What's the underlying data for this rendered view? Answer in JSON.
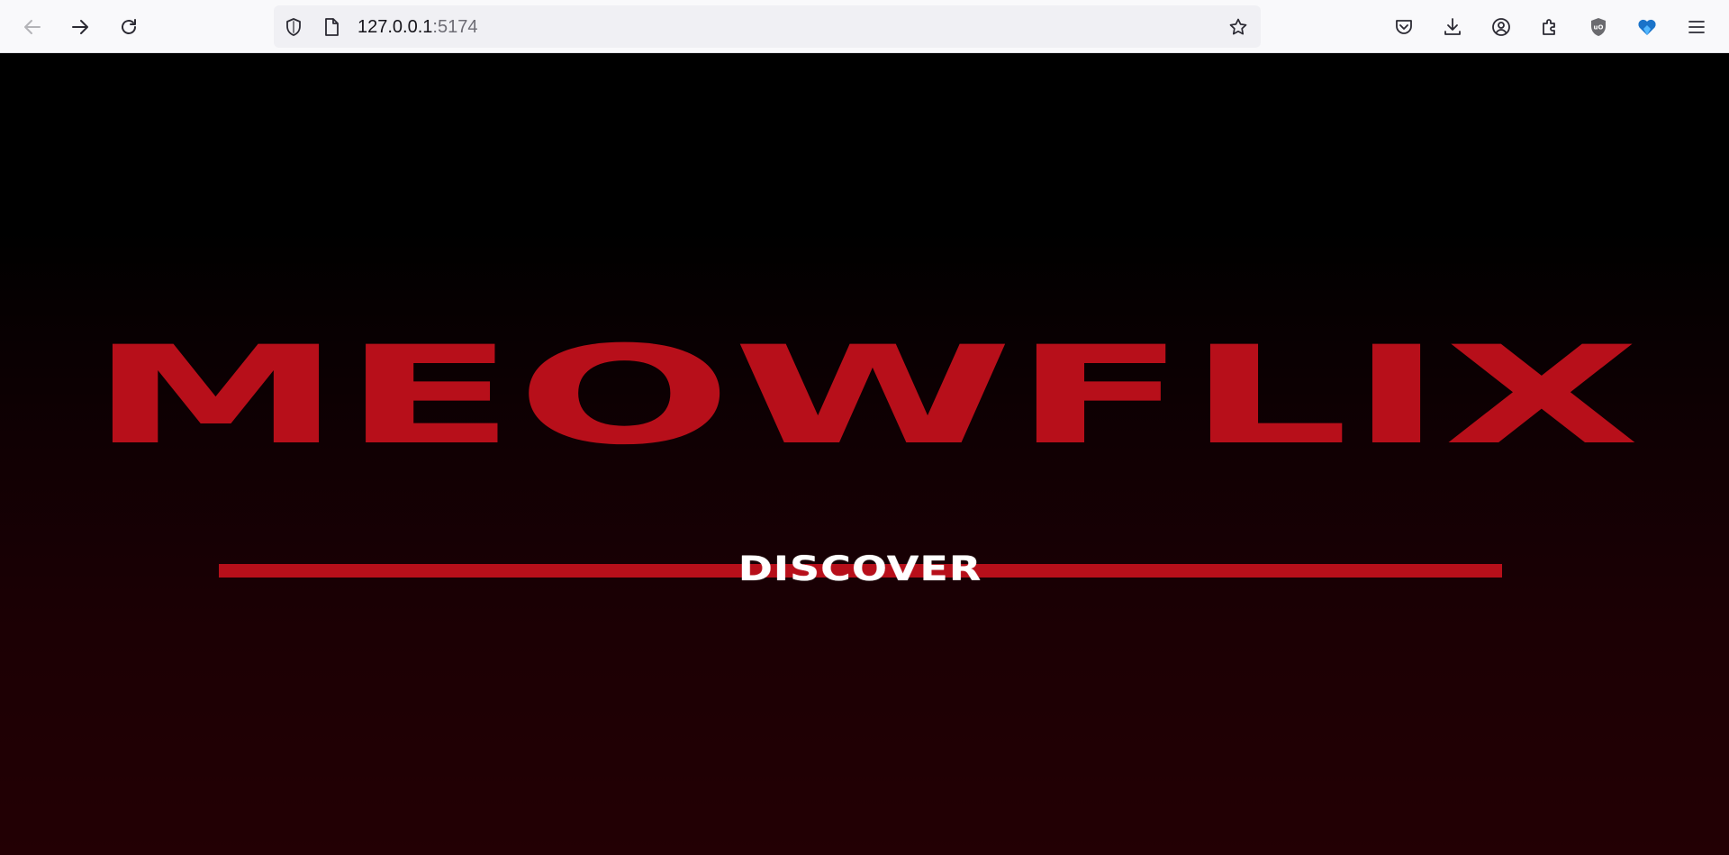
{
  "browser": {
    "url_host": "127.0.0.1",
    "url_port": ":5174",
    "icons": {
      "back": "back-arrow-icon",
      "forward": "forward-arrow-icon",
      "reload": "reload-icon",
      "site_info": "shield-icon",
      "page": "page-icon",
      "bookmark": "star-icon",
      "pocket": "pocket-icon",
      "downloads": "download-icon",
      "account": "account-icon",
      "extensions": "puzzle-icon",
      "ublock": "ublock-shield-icon",
      "extension_heart": "heart-extension-icon",
      "menu": "hamburger-menu-icon"
    }
  },
  "page": {
    "brand_title": "MEOWFLIX",
    "discover_label": "DISCOVER",
    "colors": {
      "brand_red": "#b70f1a",
      "background_top": "#000000",
      "background_bottom": "#230004",
      "discover_text": "#ffffff"
    }
  }
}
